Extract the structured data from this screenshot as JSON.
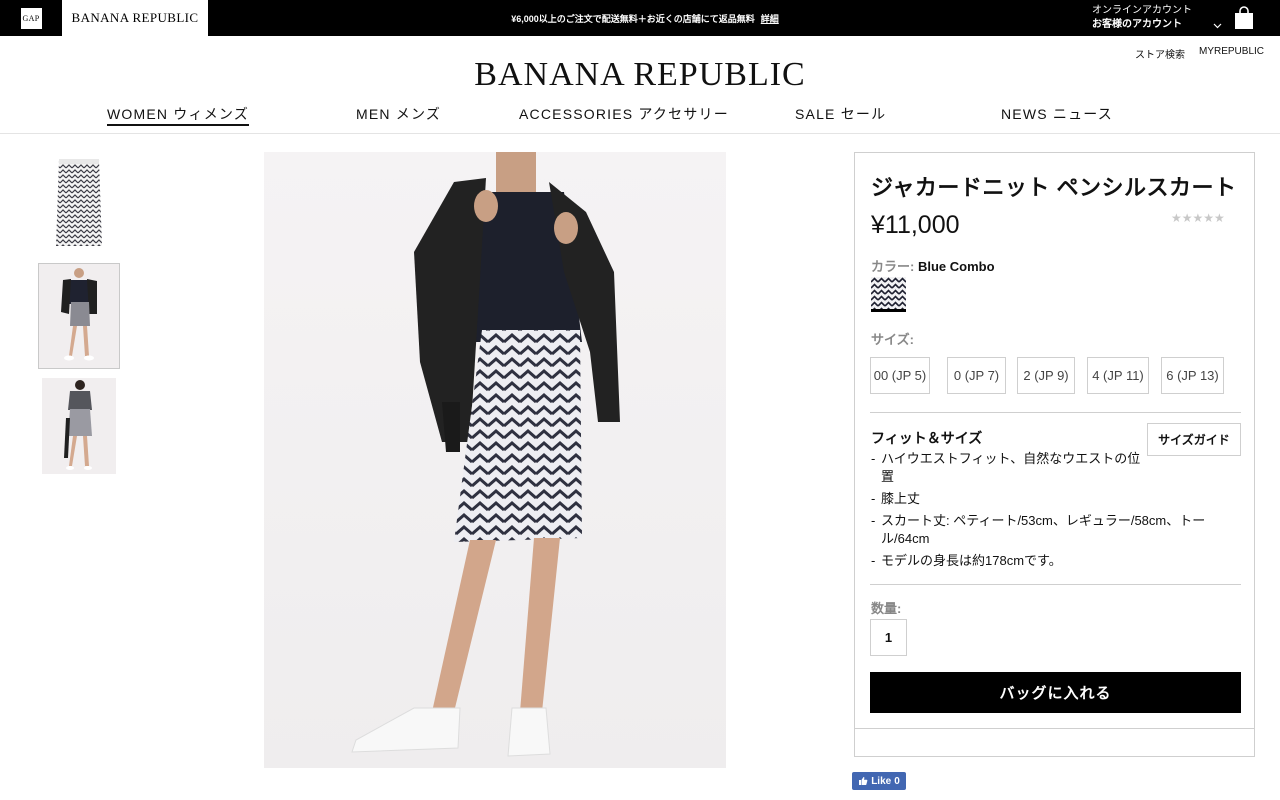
{
  "topbar": {
    "gap_logo": "GAP",
    "br_tab": "BANANA REPUBLIC",
    "promo_text": "¥6,000以上のご注文で配送無料＋お近くの店舗にて返品無料",
    "promo_link": "詳細",
    "account_line1": "オンラインアカウント",
    "account_line2": "お客様のアカウント",
    "icons": [
      "chevron-down-icon",
      "shopping-bag-icon"
    ]
  },
  "header": {
    "store_search": "ストア検索",
    "myrepublic": "MYREPUBLIC",
    "brand": "BANANA REPUBLIC"
  },
  "nav": {
    "items": [
      {
        "label": "WOMEN ウィメンズ",
        "active": true
      },
      {
        "label": "MEN メンズ",
        "active": false
      },
      {
        "label": "ACCESSORIES アクセサリー",
        "active": false
      },
      {
        "label": "SALE セール",
        "active": false
      },
      {
        "label": "NEWS ニュース",
        "active": false
      }
    ]
  },
  "gallery": {
    "thumbnails": [
      {
        "name": "skirt-flat",
        "selected": false
      },
      {
        "name": "model-front",
        "selected": true
      },
      {
        "name": "model-back",
        "selected": false
      }
    ]
  },
  "product": {
    "name": "ジャカードニット ペンシルスカート",
    "price": "¥11,000",
    "rating_stars": "★★★★★",
    "rating_value": 0,
    "color_label": "カラー:",
    "color_value": "Blue Combo",
    "size_label": "サイズ:",
    "sizes": [
      "00 (JP 5)",
      "0 (JP 7)",
      "2 (JP 9)",
      "4 (JP 11)",
      "6 (JP 13)"
    ],
    "fit_title": "フィット＆サイズ",
    "size_guide": "サイズガイド",
    "fit_details": [
      "ハイウエストフィット、自然なウエストの位置",
      "膝上丈",
      "スカート丈: ペティート/53cm、レギュラー/58cm、トール/64cm",
      "モデルの身長は約178cmです。"
    ],
    "qty_label": "数量:",
    "qty_value": "1",
    "add_to_bag": "バッグに入れる"
  },
  "social": {
    "like_label": "Like",
    "like_count": "0"
  },
  "colors": {
    "topbar_bg": "#000000",
    "button_bg": "#000000",
    "border": "#cfcfcf",
    "facebook": "#4267b2"
  }
}
